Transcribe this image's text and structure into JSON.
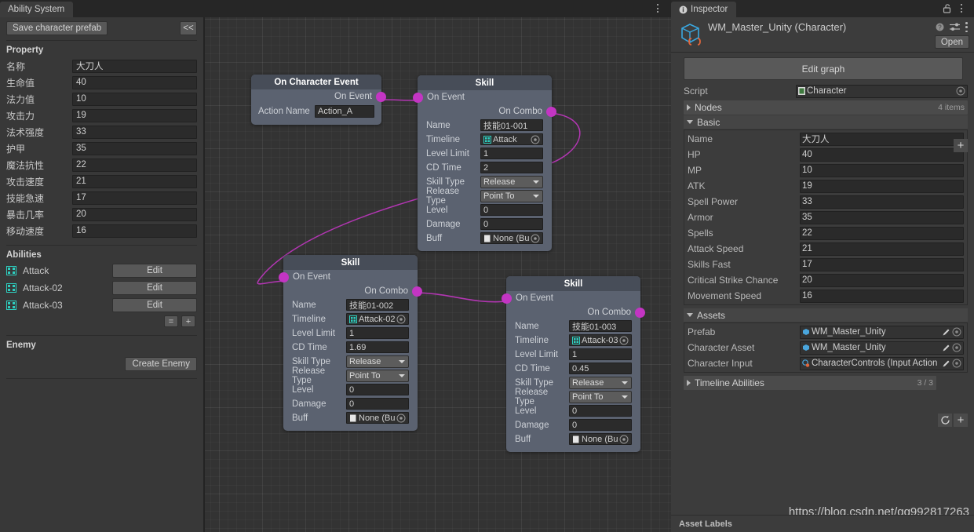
{
  "window": {
    "left_tab": "Ability System",
    "right_tab": "Inspector",
    "kebab_icon": "kebab-menu-icon",
    "lock_icon": "lock-open-icon"
  },
  "left_panel": {
    "save_button": "Save character prefab",
    "collapse_button": "<<",
    "property_title": "Property",
    "properties": [
      {
        "label": "名称",
        "value": "大刀人"
      },
      {
        "label": "生命值",
        "value": "40"
      },
      {
        "label": "法力值",
        "value": "10"
      },
      {
        "label": "攻击力",
        "value": "19"
      },
      {
        "label": "法术强度",
        "value": "33"
      },
      {
        "label": "护甲",
        "value": "35"
      },
      {
        "label": "魔法抗性",
        "value": "22"
      },
      {
        "label": "攻击速度",
        "value": "21"
      },
      {
        "label": "技能急速",
        "value": "17"
      },
      {
        "label": "暴击几率",
        "value": "20"
      },
      {
        "label": "移动速度",
        "value": "16"
      }
    ],
    "abilities_title": "Abilities",
    "abilities": [
      {
        "name": "Attack",
        "edit_label": "Edit",
        "icon": "timeline-asset-icon"
      },
      {
        "name": "Attack-02",
        "edit_label": "Edit",
        "icon": "timeline-asset-icon"
      },
      {
        "name": "Attack-03",
        "edit_label": "Edit",
        "icon": "timeline-asset-icon"
      }
    ],
    "list_minus_label": "=",
    "list_plus_label": "+",
    "enemy_title": "Enemy",
    "create_enemy_button": "Create Enemy"
  },
  "graph": {
    "event_node": {
      "title": "On Character Event",
      "out_port": "On Event",
      "action_name_label": "Action Name",
      "action_name_value": "Action_A"
    },
    "skill_nodes": [
      {
        "title": "Skill",
        "in_port": "On Event",
        "out_port": "On Combo",
        "fields": {
          "name_label": "Name",
          "name_value": "技能01-001",
          "timeline_label": "Timeline",
          "timeline_value": "Attack",
          "level_limit_label": "Level Limit",
          "level_limit_value": "1",
          "cd_time_label": "CD Time",
          "cd_time_value": "2",
          "skill_type_label": "Skill Type",
          "skill_type_value": "Release",
          "release_type_label": "Release Type",
          "release_type_value": "Point To",
          "level_label": "Level",
          "level_value": "0",
          "damage_label": "Damage",
          "damage_value": "0",
          "buff_label": "Buff",
          "buff_value": "None (Bu"
        }
      },
      {
        "title": "Skill",
        "in_port": "On Event",
        "out_port": "On Combo",
        "fields": {
          "name_label": "Name",
          "name_value": "技能01-002",
          "timeline_label": "Timeline",
          "timeline_value": "Attack-02",
          "level_limit_label": "Level Limit",
          "level_limit_value": "1",
          "cd_time_label": "CD Time",
          "cd_time_value": "1.69",
          "skill_type_label": "Skill Type",
          "skill_type_value": "Release",
          "release_type_label": "Release Type",
          "release_type_value": "Point To",
          "level_label": "Level",
          "level_value": "0",
          "damage_label": "Damage",
          "damage_value": "0",
          "buff_label": "Buff",
          "buff_value": "None (Bu"
        }
      },
      {
        "title": "Skill",
        "in_port": "On Event",
        "out_port": "On Combo",
        "fields": {
          "name_label": "Name",
          "name_value": "技能01-003",
          "timeline_label": "Timeline",
          "timeline_value": "Attack-03",
          "level_limit_label": "Level Limit",
          "level_limit_value": "1",
          "cd_time_label": "CD Time",
          "cd_time_value": "0.45",
          "skill_type_label": "Skill Type",
          "skill_type_value": "Release",
          "release_type_label": "Release Type",
          "release_type_value": "Point To",
          "level_label": "Level",
          "level_value": "0",
          "damage_label": "Damage",
          "damage_value": "0",
          "buff_label": "Buff",
          "buff_value": "None (Bu"
        }
      }
    ],
    "edge_color": "#b236b2",
    "port_color": "#c335c3"
  },
  "inspector": {
    "object_title": "WM_Master_Unity (Character)",
    "help_icon": "help-icon",
    "preset_icon": "preset-sliders-icon",
    "kebab_icon": "kebab-menu-icon",
    "open_button": "Open",
    "edit_graph_button": "Edit graph",
    "script_label": "Script",
    "script_value": "Character",
    "nodes_foldout": {
      "label": "Nodes",
      "count": "4 items",
      "add_label": "+"
    },
    "basic_foldout": "Basic",
    "basic_fields": [
      {
        "label": "Name",
        "value": "大刀人"
      },
      {
        "label": "HP",
        "value": "40"
      },
      {
        "label": "MP",
        "value": "10"
      },
      {
        "label": "ATK",
        "value": "19"
      },
      {
        "label": "Spell Power",
        "value": "33"
      },
      {
        "label": "Armor",
        "value": "35"
      },
      {
        "label": "Spells",
        "value": "22"
      },
      {
        "label": "Attack Speed",
        "value": "21"
      },
      {
        "label": "Skills Fast",
        "value": "17"
      },
      {
        "label": "Critical Strike Chance",
        "value": "20"
      },
      {
        "label": "Movement Speed",
        "value": "16"
      }
    ],
    "assets_foldout": "Assets",
    "asset_fields": [
      {
        "label": "Prefab",
        "value": "WM_Master_Unity",
        "icon": "prefab-icon"
      },
      {
        "label": "Character Asset",
        "value": "WM_Master_Unity",
        "icon": "prefab-icon"
      },
      {
        "label": "Character Input",
        "value": "CharacterControls (Input Action",
        "icon": "input-actions-icon"
      }
    ],
    "timeline_abilities_foldout": {
      "label": "Timeline Abilities",
      "count": "3 / 3",
      "refresh_label": "refresh-icon",
      "add_label": "+"
    },
    "asset_labels": "Asset Labels"
  },
  "watermark": "https://blog.csdn.net/qq992817263",
  "colors": {
    "accent_magenta": "#c335c3",
    "node_body": "#5b6270",
    "node_header": "#474d58",
    "panel_bg": "#383838",
    "inspector_bg": "#3c3c3c",
    "graph_bg": "#333333",
    "timeline_icon": "#2ecfc0"
  }
}
